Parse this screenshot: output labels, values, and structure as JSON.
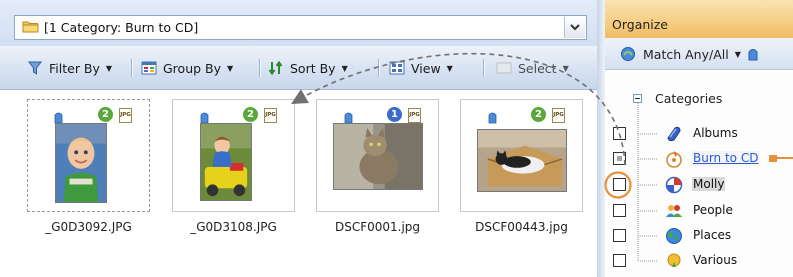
{
  "address_bar": {
    "path": "[1 Category: Burn to CD]"
  },
  "toolbar": {
    "filter_by": "Filter By",
    "group_by": "Group By",
    "sort_by": "Sort By",
    "view": "View",
    "select": "Select"
  },
  "thumbnails": [
    {
      "filename": "_G0D3092.JPG",
      "tag_count": "2",
      "file_type": "JPG"
    },
    {
      "filename": "_G0D3108.JPG",
      "tag_count": "2",
      "file_type": "JPG"
    },
    {
      "filename": "DSCF0001.jpg",
      "tag_count": "1",
      "file_type": "JPG"
    },
    {
      "filename": "DSCF00443.jpg",
      "tag_count": "2",
      "file_type": "JPG"
    }
  ],
  "organize": {
    "title": "Organize",
    "match_label": "Match Any/All",
    "categories_label": "Categories",
    "items": [
      {
        "label": "Albums",
        "icon": "albums-icon"
      },
      {
        "label": "Burn to CD",
        "icon": "burn-to-cd-icon"
      },
      {
        "label": "Molly",
        "icon": "molly-category-icon"
      },
      {
        "label": "People",
        "icon": "people-icon"
      },
      {
        "label": "Places",
        "icon": "places-icon"
      },
      {
        "label": "Various",
        "icon": "various-icon"
      }
    ]
  },
  "colors": {
    "organize_header": "#f5c97a",
    "highlight_circle": "#e8903a",
    "link": "#2a5bd7",
    "badge_green": "#5aa83a",
    "badge_blue": "#3a6cc8"
  }
}
